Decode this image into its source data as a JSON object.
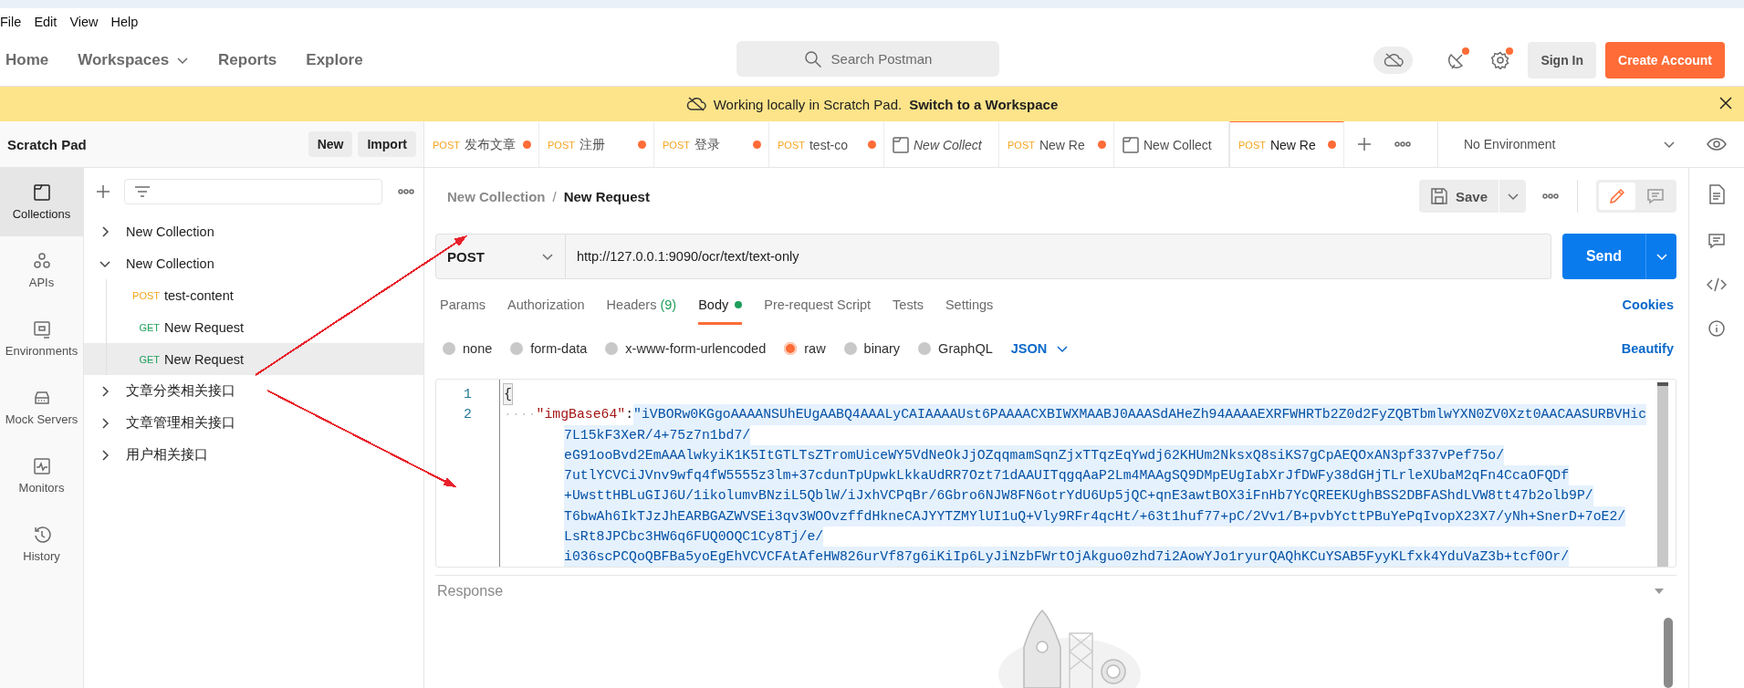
{
  "menu": [
    "File",
    "Edit",
    "View",
    "Help"
  ],
  "nav": [
    {
      "label": "Home",
      "dropdown": false
    },
    {
      "label": "Workspaces",
      "dropdown": true
    },
    {
      "label": "Reports",
      "dropdown": false
    },
    {
      "label": "Explore",
      "dropdown": false
    }
  ],
  "search": {
    "placeholder": "Search Postman"
  },
  "header_actions": {
    "notifications_badge": true,
    "settings_badge": true,
    "sign_in": "Sign In",
    "create_account": "Create Account"
  },
  "banner": {
    "text": "Working locally in Scratch Pad.",
    "link": "Switch to a Workspace"
  },
  "sidebar": {
    "title": "Scratch Pad",
    "buttons": [
      "New",
      "Import"
    ],
    "rail": [
      {
        "label": "Collections",
        "selected": true
      },
      {
        "label": "APIs",
        "selected": false
      },
      {
        "label": "Environments",
        "selected": false
      },
      {
        "label": "Mock Servers",
        "selected": false
      },
      {
        "label": "Monitors",
        "selected": false
      },
      {
        "label": "History",
        "selected": false
      }
    ],
    "tree": [
      {
        "label": "New Collection",
        "expanded": false
      },
      {
        "label": "New Collection",
        "expanded": true,
        "children": [
          {
            "method": "POST",
            "label": "test-content",
            "selected": false
          },
          {
            "method": "GET",
            "label": "New Request",
            "selected": false
          },
          {
            "method": "GET",
            "label": "New Request",
            "selected": true
          }
        ]
      },
      {
        "label": "文章分类相关接口",
        "expanded": false
      },
      {
        "label": "文章管理相关接口",
        "expanded": false
      },
      {
        "label": "用户相关接口",
        "expanded": false
      }
    ]
  },
  "tabs": [
    {
      "kind": "request",
      "method": "POST",
      "label": "发布文章",
      "unsaved": true,
      "italic": false,
      "selected": false
    },
    {
      "kind": "request",
      "method": "POST",
      "label": "注册",
      "unsaved": true,
      "italic": false,
      "selected": false
    },
    {
      "kind": "request",
      "method": "POST",
      "label": "登录",
      "unsaved": true,
      "italic": false,
      "selected": false
    },
    {
      "kind": "request",
      "method": "POST",
      "label": "test-co",
      "unsaved": true,
      "italic": false,
      "selected": false
    },
    {
      "kind": "collection",
      "label": "New Collect",
      "unsaved": false,
      "italic": true,
      "selected": false
    },
    {
      "kind": "request",
      "method": "POST",
      "label": "New Re",
      "unsaved": true,
      "italic": false,
      "selected": false
    },
    {
      "kind": "collection",
      "label": "New Collect",
      "unsaved": false,
      "italic": false,
      "selected": false
    },
    {
      "kind": "request",
      "method": "POST",
      "label": "New Re",
      "unsaved": true,
      "italic": false,
      "selected": true
    }
  ],
  "environment": {
    "label": "No Environment"
  },
  "breadcrumb": {
    "parent": "New Collection",
    "separator": "/",
    "current": "New Request"
  },
  "view_modes": [
    {
      "kind": "edit",
      "selected": true
    },
    {
      "kind": "comments",
      "selected": false
    }
  ],
  "save_button": "Save",
  "request": {
    "method": "POST",
    "url": "http://127.0.0.1:9090/ocr/text/text-only",
    "send": "Send"
  },
  "request_tabs": [
    {
      "label": "Params",
      "selected": false
    },
    {
      "label": "Authorization",
      "selected": false
    },
    {
      "label": "Headers",
      "count": "(9)",
      "selected": false
    },
    {
      "label": "Body",
      "indicator": true,
      "selected": true
    },
    {
      "label": "Pre-request Script",
      "selected": false
    },
    {
      "label": "Tests",
      "selected": false
    },
    {
      "label": "Settings",
      "selected": false
    }
  ],
  "cookies": "Cookies",
  "body_types": [
    {
      "label": "none",
      "selected": false
    },
    {
      "label": "form-data",
      "selected": false
    },
    {
      "label": "x-www-form-urlencoded",
      "selected": false
    },
    {
      "label": "raw",
      "selected": true
    },
    {
      "label": "binary",
      "selected": false
    },
    {
      "label": "GraphQL",
      "selected": false
    }
  ],
  "language": "JSON",
  "beautify": "Beautify",
  "editor": {
    "lines": [
      {
        "number": "1",
        "kind": "brace",
        "text": "{"
      },
      {
        "number": "2",
        "kind": "pair",
        "indent": "····",
        "key": "\"imgBase64\"",
        "colon": ":",
        "value_lines": [
          "\"iVBORw0KGgoAAAANSUhEUgAABQ4AAALyCAIAAAAUst6PAAAACXBIWXMAABJ0AAASdAHeZh94AAAAEXRFWHRTb2Z0d2FyZQBTbmlwYXN0ZV0Xzt0AACAASURBVHic",
          "7L15kF3XeR/4+75z7n1bd7/",
          "eG91ooBvd2EmAAAlwkyiK1K5ItGTLTsZTromUiceWY5VdNeOkJjOZqqmamSqnZjxTTqzEqYwdj62KHUm2NksxQ8siKS7gCpAEQOxAN3pf337vPef75o/",
          "7utlYCVCiJVnv9wfq4fW5555z3lm+37cdunTpUpwkLkkaUdRR7Ozt71dAAUITqgqAaP2Lm4MAAgSQ9DMpEUgIabXrJfDWFy38dGHjTLrleXUbaM2qFn4CcaOFQDf",
          "+UwsttHBLuGIJ6U/1ikolumvBNziL5QblW/iJxhVCPqBr/6Gbro6NJW8FN6otrYdU6Up5jQC+qnE3awtBOX3iFnHb7YcQREEKUghBSS2DBFAShdLVW8tt47b2olb9P/",
          "T6bwAh6IkTJzJhEARBGAZWVSEi3qv3WOOvzffdHkneCAJYYTZMYlUI1uQ+Vly9RFr4qcHt/+63t1huf77+pC/2Vv1/B+pvbYcttPBuYePqIvopX23X7/yNh+SnerD+7oE2/",
          "LsRt8JPCbc3HW6q6FUQ0OQC1Cy8Tj/e/",
          "i036scPCQoQBFBa5yoEgEhVCVCFAtAfeHW826urVf87g6iKiIp6LyJiNzbFWrtOjAkguo0zhd7i2AowYJo1ryurQAQhKCuYSAB5FyyKLfxk4YduVaZ3b+tcf0Or/"
        ]
      }
    ]
  },
  "response": {
    "label": "Response"
  },
  "annotations": [
    {
      "kind": "arrow",
      "color": "#e8202a"
    },
    {
      "kind": "arrow",
      "color": "#e8202a"
    }
  ]
}
